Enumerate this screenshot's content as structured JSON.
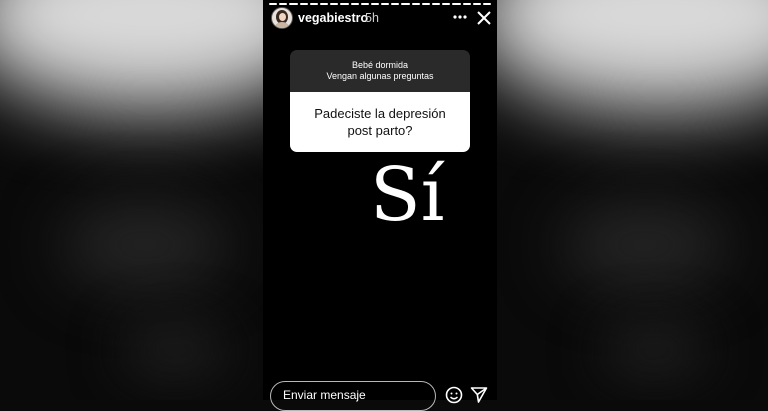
{
  "header": {
    "username": "vegabiestro",
    "time": "5h"
  },
  "icons": {
    "more": "more-options-icon",
    "close": "close-icon",
    "reaction": "reaction-icon",
    "send": "send-icon"
  },
  "sticker": {
    "prompt_line1": "Bebé dormida",
    "prompt_line2": "Vengan algunas preguntas",
    "question_line1": "Padeciste la depresión",
    "question_line2": "post parto?"
  },
  "answer": "Sí",
  "footer": {
    "message_placeholder": "Enviar mensaje"
  },
  "progress": {
    "segments": 22,
    "completed": 22
  }
}
